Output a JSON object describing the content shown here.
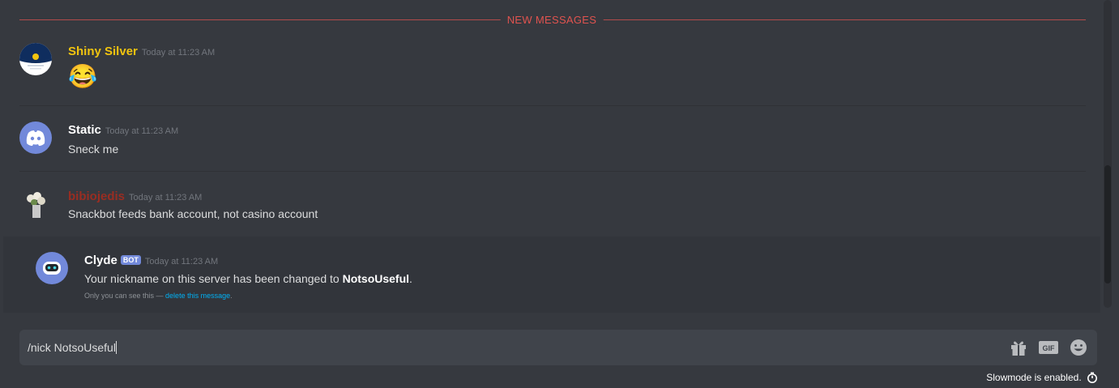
{
  "divider": {
    "label": "NEW MESSAGES"
  },
  "messages": [
    {
      "author": "Shiny Silver",
      "author_color": "#f1c40f",
      "timestamp": "Today at 11:23 AM",
      "content": "😂"
    },
    {
      "author": "Static",
      "author_color": "#ffffff",
      "timestamp": "Today at 11:23 AM",
      "content": "Sneck me"
    },
    {
      "author": "bibiojedis",
      "author_color": "#992d22",
      "timestamp": "Today at 11:23 AM",
      "content": "Snackbot feeds bank account, not casino account"
    }
  ],
  "clyde": {
    "author": "Clyde",
    "bot_tag": "BOT",
    "timestamp": "Today at 11:23 AM",
    "content_prefix": "Your nickname on this server has been changed to ",
    "nickname": "NotsoUseful",
    "content_suffix": ".",
    "ephemeral_note": "Only you can see this — ",
    "delete_link": "delete this message",
    "delete_suffix": "."
  },
  "composer": {
    "value": "/nick NotsoUseful"
  },
  "icons": [
    "gift-icon",
    "gif-icon",
    "emoji-icon",
    "timer-icon"
  ],
  "footer": {
    "slowmode": "Slowmode is enabled."
  },
  "colors": {
    "background": "#36393f",
    "accent": "#7289da",
    "divider": "#e0534f",
    "link": "#00b0f4"
  }
}
